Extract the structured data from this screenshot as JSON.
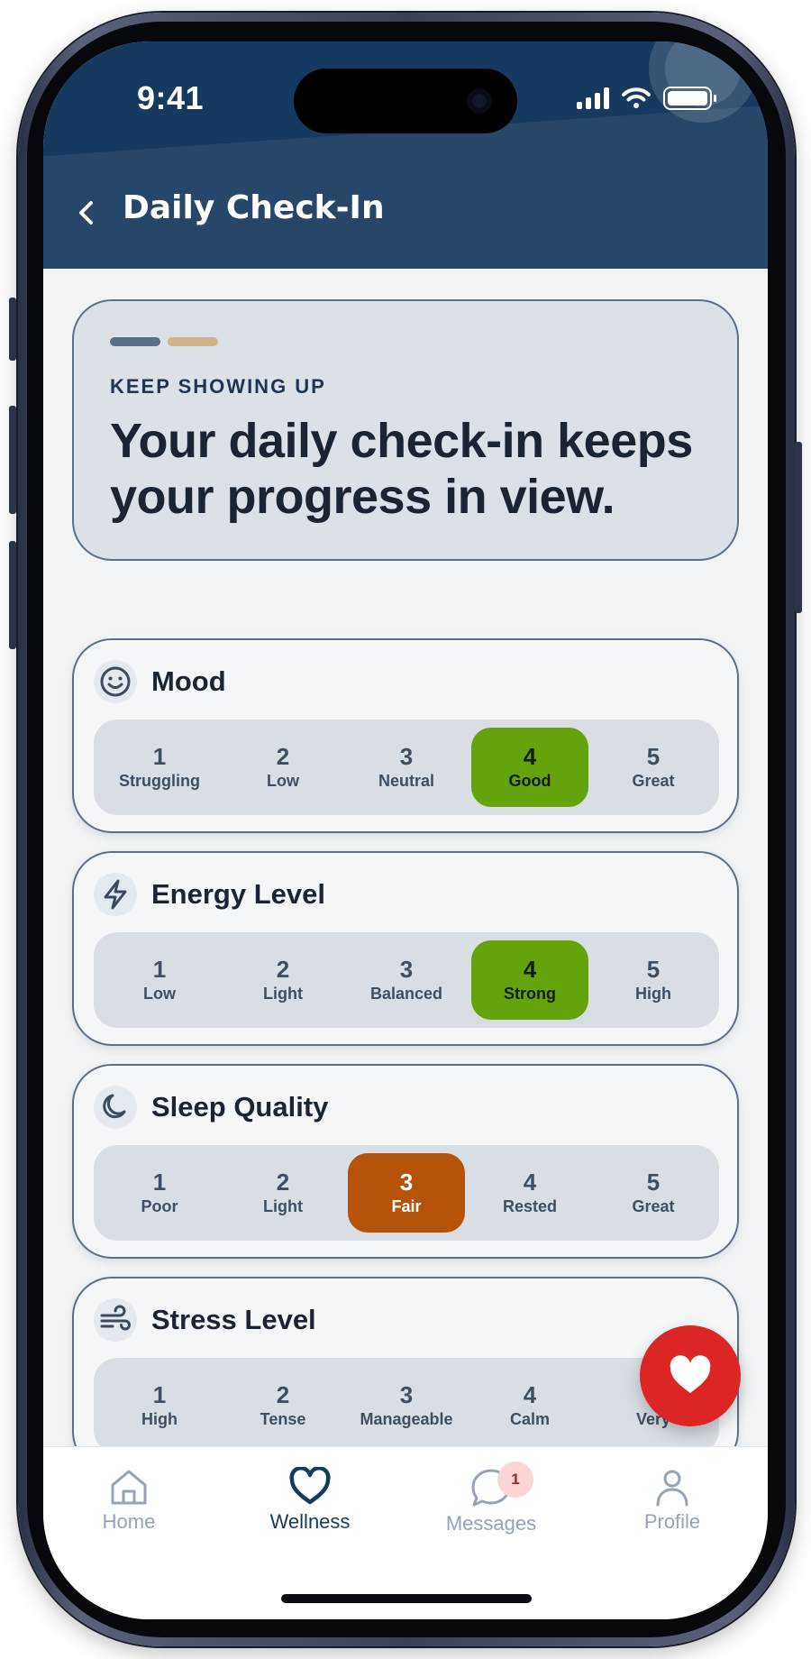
{
  "status_bar": {
    "time": "9:41"
  },
  "header": {
    "title": "Daily Check-In",
    "back_icon": "chevron-left-icon"
  },
  "hero": {
    "eyebrow": "KEEP SHOWING UP",
    "headline": "Your daily check-in keeps your progress in view."
  },
  "metrics": [
    {
      "label": "Mood",
      "icon": "smile-icon",
      "selected": 4,
      "selected_color": "#65a30d",
      "options": [
        {
          "num": "1",
          "text": "Struggling"
        },
        {
          "num": "2",
          "text": "Low"
        },
        {
          "num": "3",
          "text": "Neutral"
        },
        {
          "num": "4",
          "text": "Good"
        },
        {
          "num": "5",
          "text": "Great"
        }
      ]
    },
    {
      "label": "Energy Level",
      "icon": "lightning-icon",
      "selected": 4,
      "selected_color": "#65a30d",
      "options": [
        {
          "num": "1",
          "text": "Low"
        },
        {
          "num": "2",
          "text": "Light"
        },
        {
          "num": "3",
          "text": "Balanced"
        },
        {
          "num": "4",
          "text": "Strong"
        },
        {
          "num": "5",
          "text": "High"
        }
      ]
    },
    {
      "label": "Sleep Quality",
      "icon": "moon-icon",
      "selected": 3,
      "selected_color": "#b45309",
      "options": [
        {
          "num": "1",
          "text": "Poor"
        },
        {
          "num": "2",
          "text": "Light"
        },
        {
          "num": "3",
          "text": "Fair"
        },
        {
          "num": "4",
          "text": "Rested"
        },
        {
          "num": "5",
          "text": "Great"
        }
      ]
    },
    {
      "label": "Stress Level",
      "icon": "wind-icon",
      "selected": null,
      "selected_color": "",
      "options": [
        {
          "num": "1",
          "text": "High"
        },
        {
          "num": "2",
          "text": "Tense"
        },
        {
          "num": "3",
          "text": "Manageable"
        },
        {
          "num": "4",
          "text": "Calm"
        },
        {
          "num": "5",
          "text": "Very"
        }
      ]
    }
  ],
  "fab": {
    "icon": "heart-icon"
  },
  "tabbar": {
    "tabs": [
      {
        "label": "Home",
        "icon": "home-icon",
        "active": false
      },
      {
        "label": "Wellness",
        "icon": "heart-outline-icon",
        "active": true
      },
      {
        "label": "Messages",
        "icon": "chat-bubble-icon",
        "active": false,
        "badge": "1"
      },
      {
        "label": "Profile",
        "icon": "user-icon",
        "active": false
      }
    ]
  },
  "colors": {
    "header": "#163a5f",
    "accent_green": "#65a30d",
    "accent_orange": "#b45309",
    "fab_red": "#dc2626"
  }
}
